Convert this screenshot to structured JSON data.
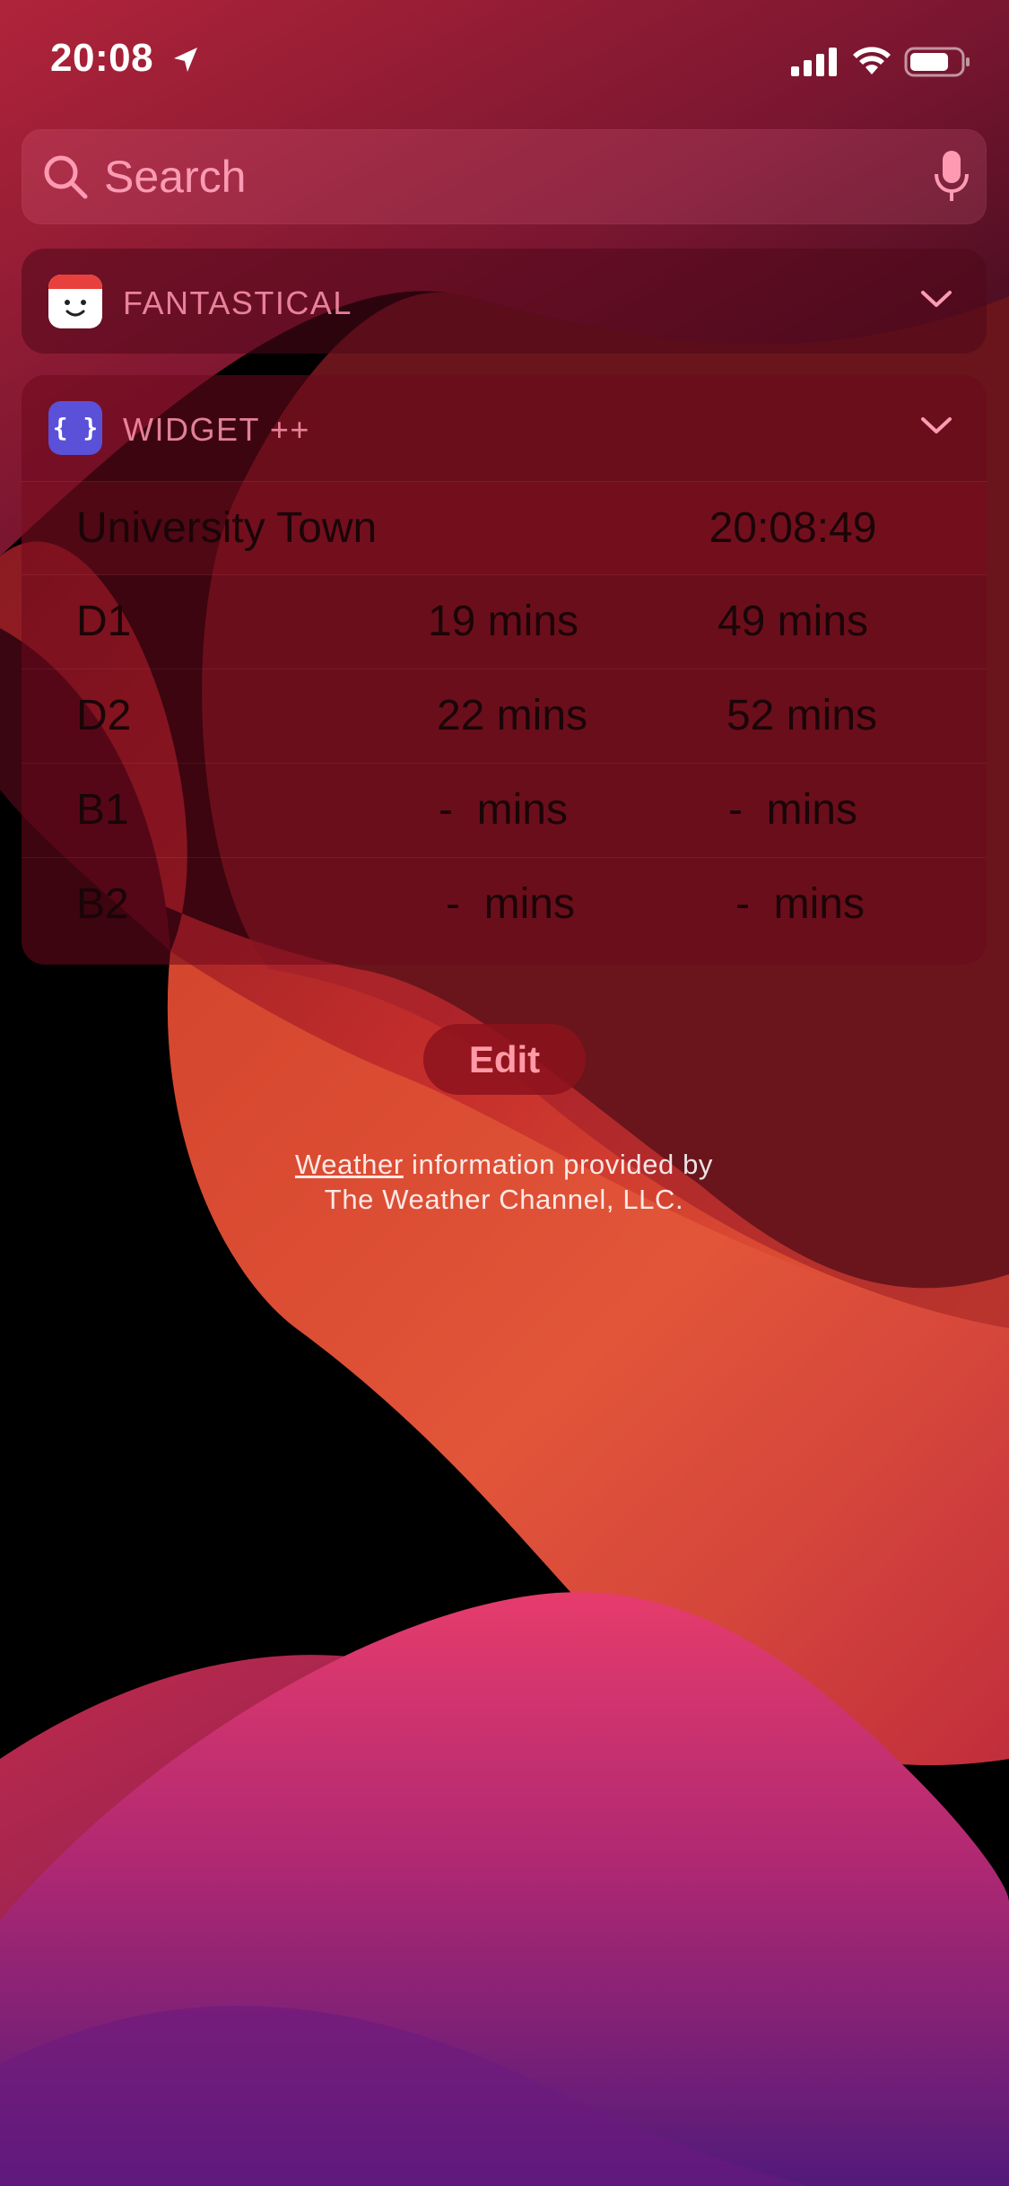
{
  "status_bar": {
    "time": "20:08",
    "icons": [
      "location-arrow-icon",
      "cellular-signal-icon",
      "wifi-icon",
      "battery-icon"
    ]
  },
  "search": {
    "placeholder": "Search",
    "icons": [
      "search-icon",
      "microphone-icon"
    ]
  },
  "widgets": [
    {
      "title": "FANTASTICAL",
      "icon": "fantastical-app-icon",
      "collapsed": true
    },
    {
      "title": "WIDGET ++",
      "icon": "widgetpp-app-icon",
      "icon_glyph": "{ }",
      "collapsed": true,
      "header": {
        "location": "University Town",
        "time": "20:08:49"
      },
      "rows": [
        {
          "route": "D1",
          "next": "19 mins",
          "after": "49 mins"
        },
        {
          "route": "D2",
          "next": "22 mins",
          "after": "52 mins"
        },
        {
          "route": "B1",
          "next": "-  mins",
          "after": "-  mins"
        },
        {
          "route": "B2",
          "next": "-  mins",
          "after": "-  mins"
        }
      ]
    }
  ],
  "edit_button": {
    "label": "Edit"
  },
  "footer": {
    "link": "Weather",
    "line1_rest": " information provided by",
    "line2": "The Weather Channel, LLC."
  },
  "colors": {
    "accent_red": "#e8413d",
    "widgetpp_icon": "#5b50d8",
    "edit_text": "#ff9aa6"
  }
}
